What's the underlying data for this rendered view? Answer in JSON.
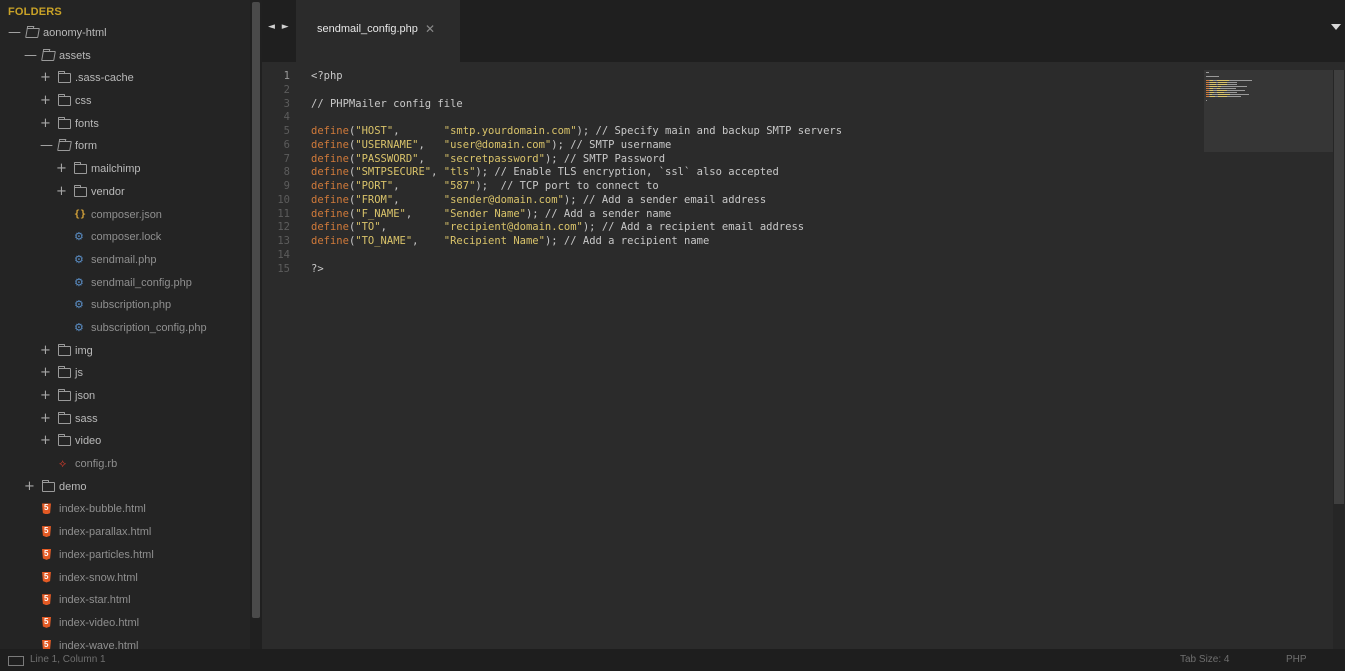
{
  "sidebar": {
    "title": "FOLDERS",
    "tree": [
      {
        "label": "aonomy-html",
        "type": "folder",
        "expander": "—",
        "open": true,
        "depth": 0
      },
      {
        "label": "assets",
        "type": "folder",
        "expander": "—",
        "open": true,
        "depth": 1
      },
      {
        "label": ".sass-cache",
        "type": "folder",
        "expander": "+",
        "open": false,
        "depth": 2
      },
      {
        "label": "css",
        "type": "folder",
        "expander": "+",
        "open": false,
        "depth": 2
      },
      {
        "label": "fonts",
        "type": "folder",
        "expander": "+",
        "open": false,
        "depth": 2
      },
      {
        "label": "form",
        "type": "folder",
        "expander": "—",
        "open": true,
        "depth": 2
      },
      {
        "label": "mailchimp",
        "type": "folder",
        "expander": "+",
        "open": false,
        "depth": 3
      },
      {
        "label": "vendor",
        "type": "folder",
        "expander": "+",
        "open": false,
        "depth": 3
      },
      {
        "label": "composer.json",
        "type": "json",
        "depth": 3
      },
      {
        "label": "composer.lock",
        "type": "gear",
        "depth": 3
      },
      {
        "label": "sendmail.php",
        "type": "gear",
        "depth": 3
      },
      {
        "label": "sendmail_config.php",
        "type": "gear",
        "depth": 3
      },
      {
        "label": "subscription.php",
        "type": "gear",
        "depth": 3
      },
      {
        "label": "subscription_config.php",
        "type": "gear",
        "depth": 3
      },
      {
        "label": "img",
        "type": "folder",
        "expander": "+",
        "open": false,
        "depth": 2
      },
      {
        "label": "js",
        "type": "folder",
        "expander": "+",
        "open": false,
        "depth": 2
      },
      {
        "label": "json",
        "type": "folder",
        "expander": "+",
        "open": false,
        "depth": 2
      },
      {
        "label": "sass",
        "type": "folder",
        "expander": "+",
        "open": false,
        "depth": 2
      },
      {
        "label": "video",
        "type": "folder",
        "expander": "+",
        "open": false,
        "depth": 2
      },
      {
        "label": "config.rb",
        "type": "ruby",
        "depth": 2
      },
      {
        "label": "demo",
        "type": "folder",
        "expander": "+",
        "open": false,
        "depth": 1
      },
      {
        "label": "index-bubble.html",
        "type": "html",
        "depth": 1
      },
      {
        "label": "index-parallax.html",
        "type": "html",
        "depth": 1
      },
      {
        "label": "index-particles.html",
        "type": "html",
        "depth": 1
      },
      {
        "label": "index-snow.html",
        "type": "html",
        "depth": 1
      },
      {
        "label": "index-star.html",
        "type": "html",
        "depth": 1
      },
      {
        "label": "index-video.html",
        "type": "html",
        "depth": 1
      },
      {
        "label": "index-wave.html",
        "type": "html",
        "depth": 1
      }
    ]
  },
  "tabbar": {
    "nav_arrows": "◄ ►",
    "active_tab": "sendmail_config.php",
    "close_glyph": "✕"
  },
  "editor": {
    "active_line": 1,
    "lines": [
      [
        {
          "t": "<?php",
          "c": "plain"
        }
      ],
      [],
      [
        {
          "t": "// PHPMailer config file",
          "c": "cm"
        }
      ],
      [],
      [
        {
          "t": "define",
          "c": "fn"
        },
        {
          "t": "(",
          "c": "plain"
        },
        {
          "t": "\"HOST\"",
          "c": "str"
        },
        {
          "t": ",       ",
          "c": "plain"
        },
        {
          "t": "\"smtp.yourdomain.com\"",
          "c": "str"
        },
        {
          "t": "); // Specify main and backup SMTP servers",
          "c": "plain"
        }
      ],
      [
        {
          "t": "define",
          "c": "fn"
        },
        {
          "t": "(",
          "c": "plain"
        },
        {
          "t": "\"USERNAME\"",
          "c": "str"
        },
        {
          "t": ",   ",
          "c": "plain"
        },
        {
          "t": "\"user@domain.com\"",
          "c": "str"
        },
        {
          "t": "); // SMTP username",
          "c": "plain"
        }
      ],
      [
        {
          "t": "define",
          "c": "fn"
        },
        {
          "t": "(",
          "c": "plain"
        },
        {
          "t": "\"PASSWORD\"",
          "c": "str"
        },
        {
          "t": ",   ",
          "c": "plain"
        },
        {
          "t": "\"secretpassword\"",
          "c": "str"
        },
        {
          "t": "); // SMTP Password",
          "c": "plain"
        }
      ],
      [
        {
          "t": "define",
          "c": "fn"
        },
        {
          "t": "(",
          "c": "plain"
        },
        {
          "t": "\"SMTPSECURE\"",
          "c": "str"
        },
        {
          "t": ", ",
          "c": "plain"
        },
        {
          "t": "\"tls\"",
          "c": "str"
        },
        {
          "t": "); // Enable TLS encryption, `ssl` also accepted",
          "c": "plain"
        }
      ],
      [
        {
          "t": "define",
          "c": "fn"
        },
        {
          "t": "(",
          "c": "plain"
        },
        {
          "t": "\"PORT\"",
          "c": "str"
        },
        {
          "t": ",       ",
          "c": "plain"
        },
        {
          "t": "\"587\"",
          "c": "str"
        },
        {
          "t": ");  // TCP port to connect to",
          "c": "plain"
        }
      ],
      [
        {
          "t": "define",
          "c": "fn"
        },
        {
          "t": "(",
          "c": "plain"
        },
        {
          "t": "\"FROM\"",
          "c": "str"
        },
        {
          "t": ",       ",
          "c": "plain"
        },
        {
          "t": "\"sender@domain.com\"",
          "c": "str"
        },
        {
          "t": "); // Add a sender email address",
          "c": "plain"
        }
      ],
      [
        {
          "t": "define",
          "c": "fn"
        },
        {
          "t": "(",
          "c": "plain"
        },
        {
          "t": "\"F_NAME\"",
          "c": "str"
        },
        {
          "t": ",     ",
          "c": "plain"
        },
        {
          "t": "\"Sender Name\"",
          "c": "str"
        },
        {
          "t": "); // Add a sender name",
          "c": "plain"
        }
      ],
      [
        {
          "t": "define",
          "c": "fn"
        },
        {
          "t": "(",
          "c": "plain"
        },
        {
          "t": "\"TO\"",
          "c": "str"
        },
        {
          "t": ",         ",
          "c": "plain"
        },
        {
          "t": "\"recipient@domain.com\"",
          "c": "str"
        },
        {
          "t": "); // Add a recipient email address",
          "c": "plain"
        }
      ],
      [
        {
          "t": "define",
          "c": "fn"
        },
        {
          "t": "(",
          "c": "plain"
        },
        {
          "t": "\"TO_NAME\"",
          "c": "str"
        },
        {
          "t": ",    ",
          "c": "plain"
        },
        {
          "t": "\"Recipient Name\"",
          "c": "str"
        },
        {
          "t": "); // Add a recipient name",
          "c": "plain"
        }
      ],
      [],
      [
        {
          "t": "?>",
          "c": "plain"
        }
      ]
    ]
  },
  "statusbar": {
    "position": "Line 1, Column 1",
    "tab_size": "Tab Size: 4",
    "syntax": "PHP"
  },
  "colors": {
    "function": "#d07a3a",
    "string": "#d9c36a",
    "folders_title": "#c9a227",
    "html_icon": "#e35a24",
    "gear_icon": "#5b8fc7",
    "ruby_icon": "#c23a2b"
  }
}
